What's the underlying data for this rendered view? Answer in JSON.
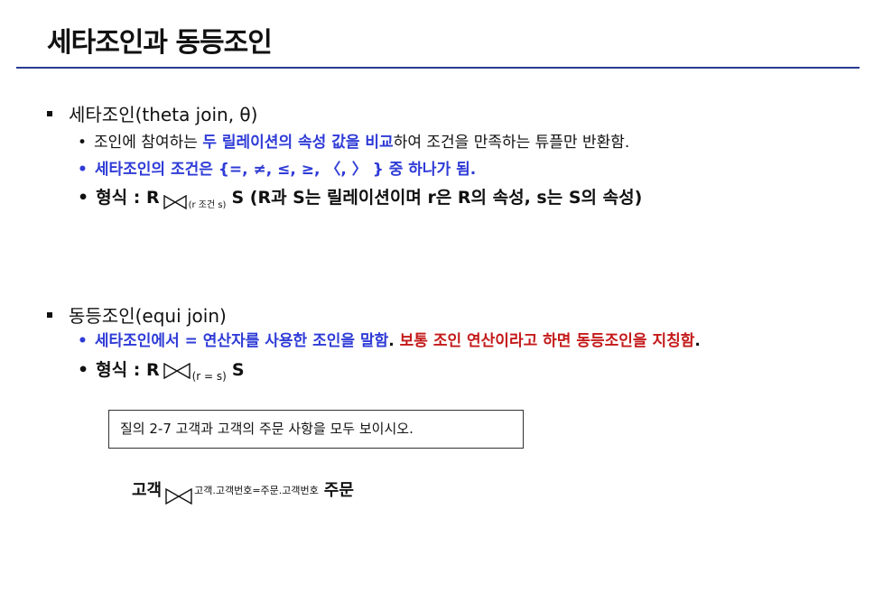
{
  "title": "세타조인과 동등조인",
  "theta": {
    "heading": "세타조인(theta join, θ)",
    "desc_before": "조인에 참여하는 ",
    "desc_highlight": "두 릴레이션의 속성 값을 비교",
    "desc_after": "하여 조건을 만족하는 튜플만 반환함.",
    "condition": "세타조인의 조건은 {=, ≠, ≤, ≥,  〈, 〉 } 중 하나가 됨.",
    "form_label": "형식 : R",
    "form_subscript": "(r 조건 s)",
    "form_rest": "S (R과 S는 릴레이션이며 r은 R의 속성, s는 S의 속성)"
  },
  "equi": {
    "heading": "동등조인(equi join)",
    "desc_blue": "세타조인에서 = 연산자를 사용한 조인을 말함",
    "desc_period": ". ",
    "desc_red": "보통 조인 연산이라고 하면 동등조인을 지칭함",
    "desc_end": ".",
    "form_label": "형식 : R",
    "form_subscript": "(r = s)",
    "form_rest": "S"
  },
  "example": {
    "box_text": "질의 2-7   고객과 고객의 주문 사항을 모두 보이시오.",
    "left": "고객",
    "condition": "고객.고객번호=주문.고객번호",
    "right": "주문"
  },
  "colors": {
    "rule": "#2b3a8f",
    "highlight_blue": "#2e3bd6",
    "highlight_red": "#c41a1a"
  },
  "icons": {
    "bullet": "square-bullet-icon",
    "join": "bowtie-join-icon"
  }
}
